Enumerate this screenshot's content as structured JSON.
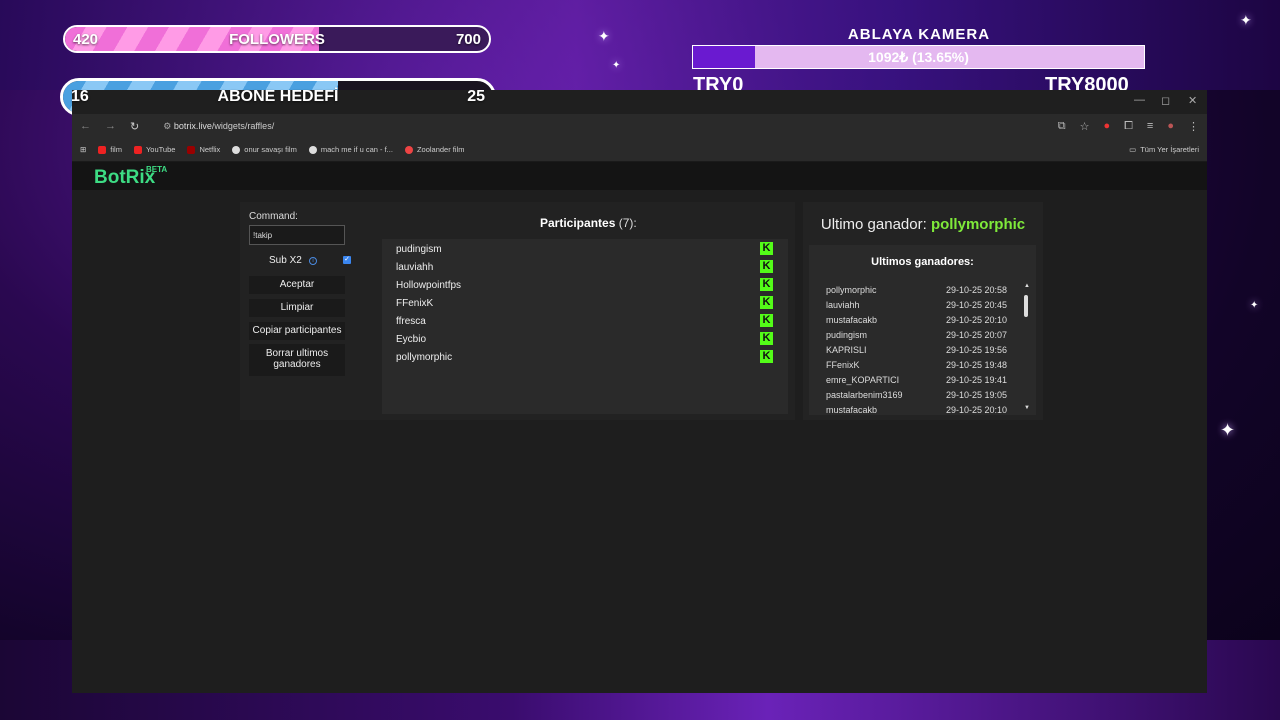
{
  "overlay": {
    "followers": {
      "current": "420",
      "label": "FOLLOWERS",
      "target": "700",
      "progress": 0.6
    },
    "abone": {
      "current": "16",
      "label": "ABONE HEDEFİ",
      "target": "25",
      "progress": 0.64
    },
    "kamera": {
      "title": "ABLAYA KAMERA",
      "amount": "1092₺ (13.65%)",
      "start": "TRY0",
      "end": "TRY8000",
      "progress": 0.1365
    }
  },
  "browser": {
    "url_host": "botrix.live",
    "url_path": "/widgets/raffles/",
    "bookmarks": [
      "film",
      "YouTube",
      "Netflix",
      "onur savaşı film",
      "mach me if u can - f...",
      "Zoolander film"
    ],
    "bookmarks_all": "Tüm Yer İşaretleri",
    "win_controls": {
      "min": "—",
      "max": "◻",
      "close": "✕"
    }
  },
  "app": {
    "logo": "BotRix",
    "logo_badge": "BETA",
    "command_label": "Command:",
    "command_value": "!takip",
    "sub_x2_label": "Sub X2",
    "sub_x2_checked": true,
    "buttons": {
      "aceptar": "Aceptar",
      "limpiar": "Limpiar",
      "copiar": "Copiar participantes",
      "borrar": "Borrar ultimos ganadores"
    },
    "participants_title": "Participantes",
    "participants_count": "(7):",
    "participants": [
      "pudingism",
      "lauviahh",
      "Hollowpointfps",
      "FFenixK",
      "ffresca",
      "Eycbio",
      "pollymorphic"
    ],
    "winner_label": "Ultimo ganador:",
    "winner_name": "pollymorphic",
    "winners_title": "Ultimos ganadores:",
    "winners": [
      {
        "name": "pollymorphic",
        "date": "29-10-25 20:58"
      },
      {
        "name": "lauviahh",
        "date": "29-10-25 20:45"
      },
      {
        "name": "mustafacakb",
        "date": "29-10-25 20:10"
      },
      {
        "name": "pudingism",
        "date": "29-10-25 20:07"
      },
      {
        "name": "KAPRISLI",
        "date": "29-10-25 19:56"
      },
      {
        "name": "FFenixK",
        "date": "29-10-25 19:48"
      },
      {
        "name": "emre_KOPARTICI",
        "date": "29-10-25 19:41"
      },
      {
        "name": "pastalarbenim3169",
        "date": "29-10-25 19:05"
      },
      {
        "name": "mustafacakb",
        "date": "29-10-25 20:10"
      }
    ]
  }
}
